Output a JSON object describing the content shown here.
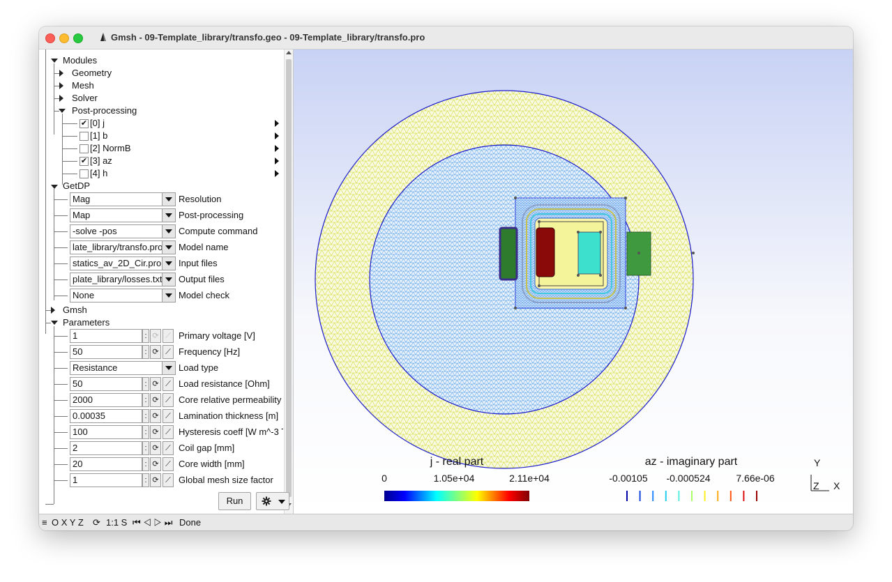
{
  "window": {
    "title": "Gmsh - 09-Template_library/transfo.geo - 09-Template_library/transfo.pro"
  },
  "tree": {
    "modules": "Modules",
    "geometry": "Geometry",
    "mesh": "Mesh",
    "solver": "Solver",
    "post_processing": "Post-processing",
    "views": [
      {
        "label": "[0] j",
        "checked": true
      },
      {
        "label": "[1] b",
        "checked": false
      },
      {
        "label": "[2] NormB",
        "checked": false
      },
      {
        "label": "[3] az",
        "checked": true
      },
      {
        "label": "[4] h",
        "checked": false
      }
    ],
    "getdp": "GetDP",
    "gmsh": "Gmsh",
    "parameters": "Parameters"
  },
  "getdp_fields": [
    {
      "value": "Mag",
      "label": "Resolution"
    },
    {
      "value": "Map",
      "label": "Post-processing"
    },
    {
      "value": "-solve -pos",
      "label": "Compute command"
    },
    {
      "value": "late_library/transfo.pro",
      "label": "Model name"
    },
    {
      "value": "statics_av_2D_Cir.pro",
      "label": "Input files"
    },
    {
      "value": "plate_library/losses.txt",
      "label": "Output files"
    },
    {
      "value": "None",
      "label": "Model check"
    }
  ],
  "parameters": [
    {
      "value": "1",
      "label": "Primary voltage [V]",
      "type": "number",
      "dim": true
    },
    {
      "value": "50",
      "label": "Frequency [Hz]",
      "type": "number",
      "dim": false
    },
    {
      "value": "Resistance",
      "label": "Load type",
      "type": "choice",
      "dim": false
    },
    {
      "value": "50",
      "label": "Load resistance [Ohm]",
      "type": "number",
      "dim": false
    },
    {
      "value": "2000",
      "label": "Core relative permeability",
      "type": "number",
      "dim": false
    },
    {
      "value": "0.00035",
      "label": "Lamination thickness [m]",
      "type": "number",
      "dim": false
    },
    {
      "value": "100",
      "label": "Hysteresis coeff [W m^-3 T",
      "type": "number",
      "dim": false
    },
    {
      "value": "2",
      "label": "Coil gap [mm]",
      "type": "number",
      "dim": false
    },
    {
      "value": "20",
      "label": "Core width [mm]",
      "type": "number",
      "dim": false
    },
    {
      "value": "1",
      "label": "Global mesh size factor",
      "type": "number",
      "dim": false
    }
  ],
  "param_glyphs": {
    "colon": ":",
    "loop": "⟳",
    "graph": "⟋"
  },
  "buttons": {
    "run": "Run"
  },
  "scale_j": {
    "title": "j - real part",
    "ticks": [
      "0",
      "1.05e+04",
      "2.11e+04"
    ]
  },
  "scale_az": {
    "title": "az - imaginary part",
    "ticks": [
      "-0.00105",
      "-0.000524",
      "7.66e-06"
    ],
    "colors": [
      "#0000aa",
      "#1144dd",
      "#2288ff",
      "#22ccee",
      "#55eedd",
      "#aaff66",
      "#ffee22",
      "#ffaa11",
      "#ff5511",
      "#dd1111",
      "#990000"
    ]
  },
  "axes": {
    "y": "Y",
    "z": "Z",
    "x": "X"
  },
  "status": {
    "icons": "≡",
    "view_buttons": "O X Y Z",
    "rotate": "⟳",
    "scale": "1:1 S",
    "anim": "⏮ ◁ ▷ ⏭",
    "message": "Done"
  }
}
